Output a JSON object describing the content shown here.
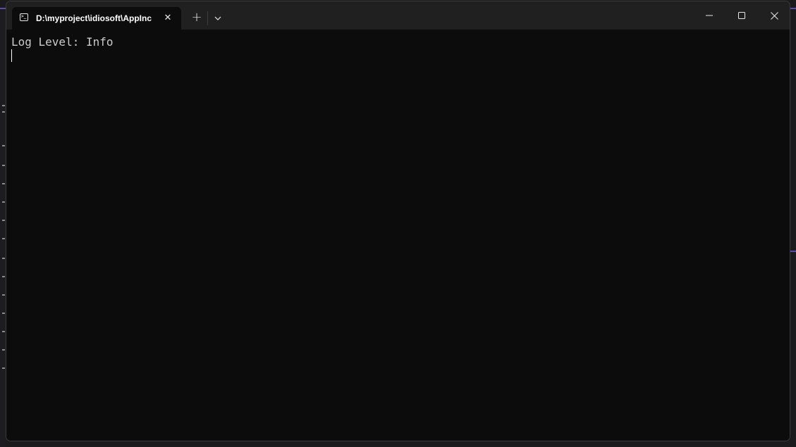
{
  "window": {
    "tab_title": "D:\\myproject\\idiosoft\\AppInc",
    "tab_icon": "terminal-icon",
    "close_tab_glyph": "✕",
    "new_tab_glyph": "+",
    "dropdown_icon": "chevron-down-icon",
    "minimize_icon": "minimize-icon",
    "maximize_icon": "maximize-icon",
    "close_icon": "close-icon"
  },
  "terminal": {
    "lines": [
      "Log Level: Info"
    ],
    "background": "#0c0c0c",
    "foreground": "#cccccc"
  },
  "colors": {
    "titlebar": "#202020",
    "accent": "#6a5acd"
  }
}
